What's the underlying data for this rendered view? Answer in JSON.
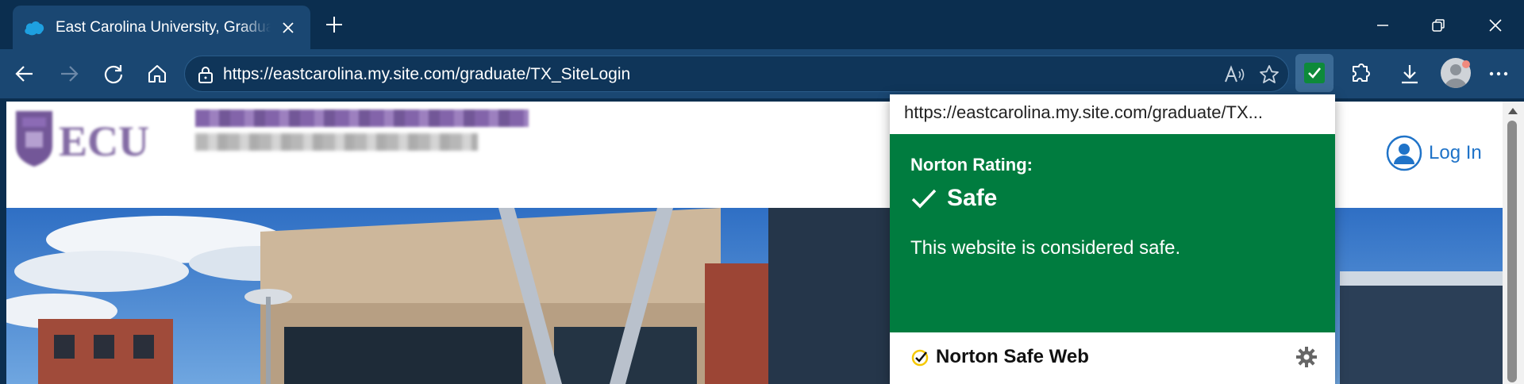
{
  "browser": {
    "tab": {
      "title": "East Carolina University, Graduate School Application",
      "favicon": "salesforce-cloud-icon"
    },
    "address_bar": {
      "url": "https://eastcarolina.my.site.com/graduate/TX_SiteLogin"
    },
    "toolbar_icons": [
      "back-icon",
      "forward-icon",
      "refresh-icon",
      "home-icon",
      "read-aloud-icon",
      "favorite-star-icon",
      "norton-extension-icon",
      "extensions-icon",
      "downloads-icon",
      "profile-avatar",
      "more-icon"
    ],
    "window_controls": [
      "minimize-icon",
      "restore-icon",
      "close-icon"
    ]
  },
  "page": {
    "header": {
      "login_label": "Log In"
    }
  },
  "norton_popup": {
    "url": "https://eastcarolina.my.site.com/graduate/TX...",
    "rating_label": "Norton Rating:",
    "status": "Safe",
    "description": "This website is considered safe.",
    "brand": "Norton Safe Web",
    "colors": {
      "green": "#007c3f",
      "accent_yellow": "#f5c800"
    }
  },
  "colors": {
    "tabstrip_bg": "#0b2e4f",
    "toolbar_bg": "#1a4772",
    "link_blue": "#1f73c8"
  }
}
